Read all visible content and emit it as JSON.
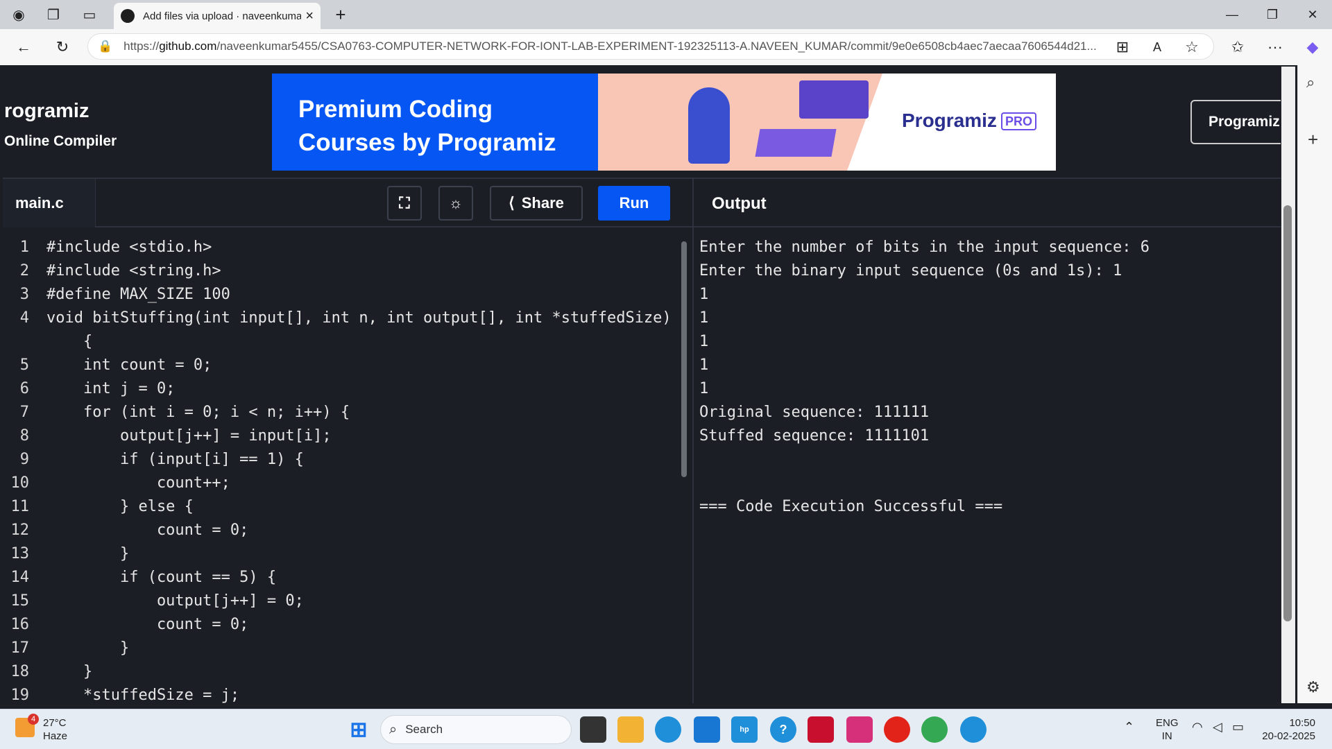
{
  "browser": {
    "tab_title": "Add files via upload · naveenkuma",
    "url_prefix": "https://",
    "url_domain": "github.com",
    "url_path": "/naveenkumar5455/CSA0763-COMPUTER-NETWORK-FOR-IONT-LAB-EXPERIMENT-192325113-A.NAVEEN_KUMAR/commit/9e0e6508cb4aec7aecaa7606544d21...",
    "read_aloud": "A",
    "new_tab": "+"
  },
  "page": {
    "logo_title": "rogramiz",
    "logo_subtitle": "Online Compiler",
    "banner_line1": "Premium Coding",
    "banner_line2": "Courses by Programiz",
    "banner_logo": "Programiz",
    "banner_pro": "PRO",
    "programiz_btn": "Programiz",
    "file_name": "main.c",
    "share_label": "Share",
    "run_label": "Run",
    "output_label": "Output"
  },
  "code_lines": [
    {
      "n": "1",
      "text": "#include <stdio.h>"
    },
    {
      "n": "2",
      "text": "#include <string.h>"
    },
    {
      "n": "3",
      "text": "#define MAX_SIZE 100"
    },
    {
      "n": "4",
      "text": "void bitStuffing(int input[], int n, int output[], int *stuffedSize)"
    },
    {
      "n": "",
      "text": "    {"
    },
    {
      "n": "5",
      "text": "    int count = 0;"
    },
    {
      "n": "6",
      "text": "    int j = 0;"
    },
    {
      "n": "7",
      "text": "    for (int i = 0; i < n; i++) {"
    },
    {
      "n": "8",
      "text": "        output[j++] = input[i];"
    },
    {
      "n": "9",
      "text": "        if (input[i] == 1) {"
    },
    {
      "n": "10",
      "text": "            count++;"
    },
    {
      "n": "11",
      "text": "        } else {"
    },
    {
      "n": "12",
      "text": "            count = 0;"
    },
    {
      "n": "13",
      "text": "        }"
    },
    {
      "n": "14",
      "text": "        if (count == 5) {"
    },
    {
      "n": "15",
      "text": "            output[j++] = 0;"
    },
    {
      "n": "16",
      "text": "            count = 0;"
    },
    {
      "n": "17",
      "text": "        }"
    },
    {
      "n": "18",
      "text": "    }"
    },
    {
      "n": "19",
      "text": "    *stuffedSize = j;"
    }
  ],
  "output_lines": [
    "Enter the number of bits in the input sequence: 6",
    "Enter the binary input sequence (0s and 1s): 1",
    "1",
    "1",
    "1",
    "1",
    "1",
    "Original sequence: 111111",
    "Stuffed sequence: 1111101",
    "",
    "",
    "=== Code Execution Successful ==="
  ],
  "taskbar": {
    "weather_temp": "27°C",
    "weather_desc": "Haze",
    "weather_badge": "4",
    "search_label": "Search",
    "lang1": "ENG",
    "lang2": "IN",
    "time": "10:50",
    "date": "20-02-2025"
  }
}
